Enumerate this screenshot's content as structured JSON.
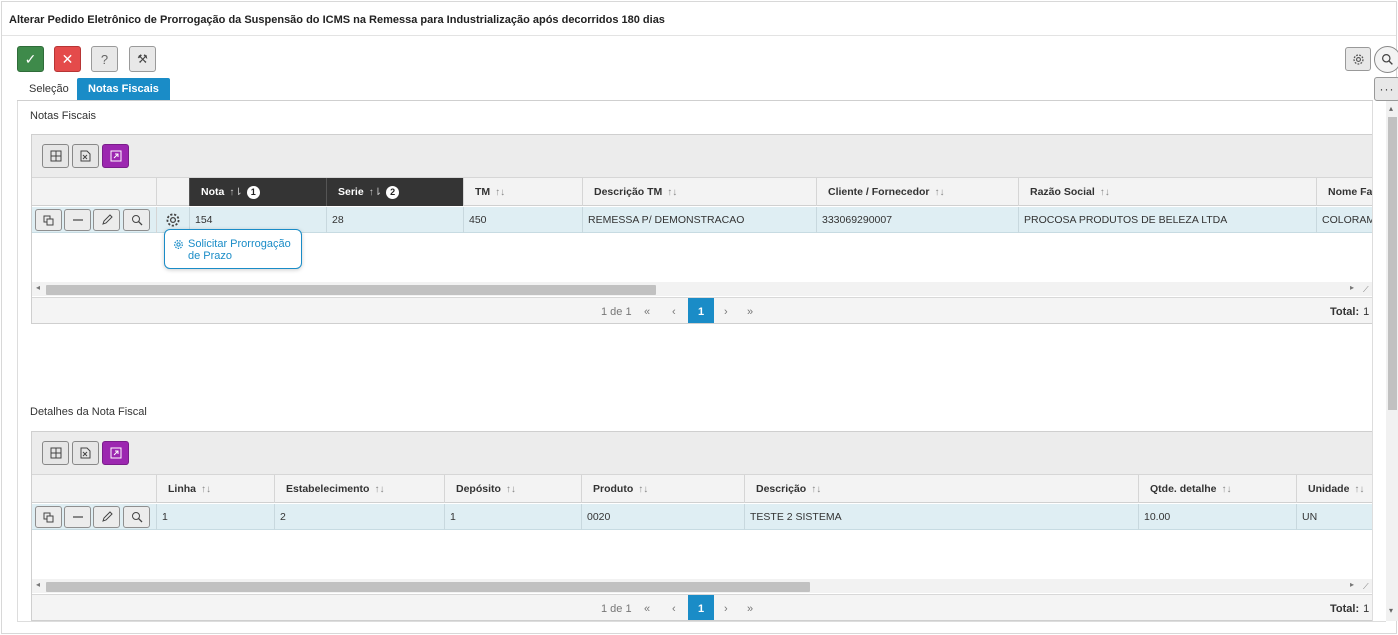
{
  "title": "Alterar Pedido Eletrônico de Prorrogação da Suspensão do ICMS na Remessa para Industrialização após decorridos 180 dias",
  "toolbar": {
    "ok": "✓",
    "cancel": "✕",
    "help": "?",
    "tool": "⚒"
  },
  "right_tools": {
    "more": "···"
  },
  "tabs": [
    {
      "label": "Seleção",
      "active": false
    },
    {
      "label": "Notas Fiscais",
      "active": true
    }
  ],
  "section1": {
    "title": "Notas Fiscais",
    "columns": [
      {
        "label": "Nota",
        "badge": "1",
        "sorted": true
      },
      {
        "label": "Serie",
        "badge": "2",
        "sorted": true
      },
      {
        "label": "TM"
      },
      {
        "label": "Descrição TM"
      },
      {
        "label": "Cliente / Fornecedor"
      },
      {
        "label": "Razão Social"
      },
      {
        "label": "Nome Far"
      }
    ],
    "row": [
      "154",
      "28",
      "450",
      "REMESSA P/ DEMONSTRACAO",
      "333069290007",
      "PROCOSA PRODUTOS DE BELEZA LTDA",
      "COLORAMA"
    ],
    "pager": {
      "info": "1 de 1",
      "page": "1",
      "total_label": "Total:",
      "total": "1"
    },
    "popup_line1": "Solicitar Prorrogação",
    "popup_line2": "de Prazo"
  },
  "section2": {
    "title": "Detalhes da Nota Fiscal",
    "columns": [
      {
        "label": "Linha"
      },
      {
        "label": "Estabelecimento"
      },
      {
        "label": "Depósito"
      },
      {
        "label": "Produto"
      },
      {
        "label": "Descrição"
      },
      {
        "label": "Qtde. detalhe"
      },
      {
        "label": "Unidade"
      }
    ],
    "row": [
      "1",
      "2",
      "1",
      "0020",
      "TESTE 2 SISTEMA",
      "10.00",
      "UN"
    ],
    "pager": {
      "info": "1 de 1",
      "page": "1",
      "total_label": "Total:",
      "total": "1"
    }
  },
  "colors": {
    "accent": "#1a8cc7",
    "ok": "#3e8a4a",
    "cancel": "#e44b4b",
    "expand": "#9c27b0",
    "row": "#dfeef3"
  }
}
